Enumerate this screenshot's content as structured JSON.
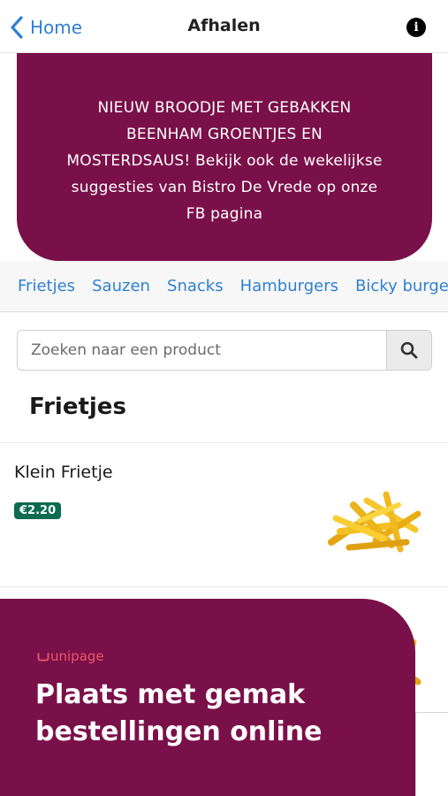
{
  "nav": {
    "back_label": "Home",
    "title": "Afhalen",
    "info_glyph": "i"
  },
  "banner": {
    "text": "NIEUW BROODJE MET GEBAKKEN BEENHAM GROENTJES EN MOSTERDSAUS! Bekijk ook de wekelijkse suggesties van Bistro De Vrede op onze FB pagina"
  },
  "categories": [
    "Frietjes",
    "Sauzen",
    "Snacks",
    "Hamburgers",
    "Bicky burgers"
  ],
  "search": {
    "placeholder": "Zoeken naar een product",
    "icon": "search-icon"
  },
  "section": {
    "title": "Frietjes"
  },
  "products": [
    {
      "name": "Klein Frietje",
      "price": "€2.20",
      "image": "fries-image"
    }
  ],
  "promo": {
    "logo": "unipage",
    "headline_line1": "Plaats met gemak",
    "headline_line2": "bestellingen online"
  },
  "colors": {
    "brand": "#7a1049",
    "link": "#2f80d1",
    "price_badge": "#0d6b4f",
    "logo_accent": "#e85a69"
  }
}
